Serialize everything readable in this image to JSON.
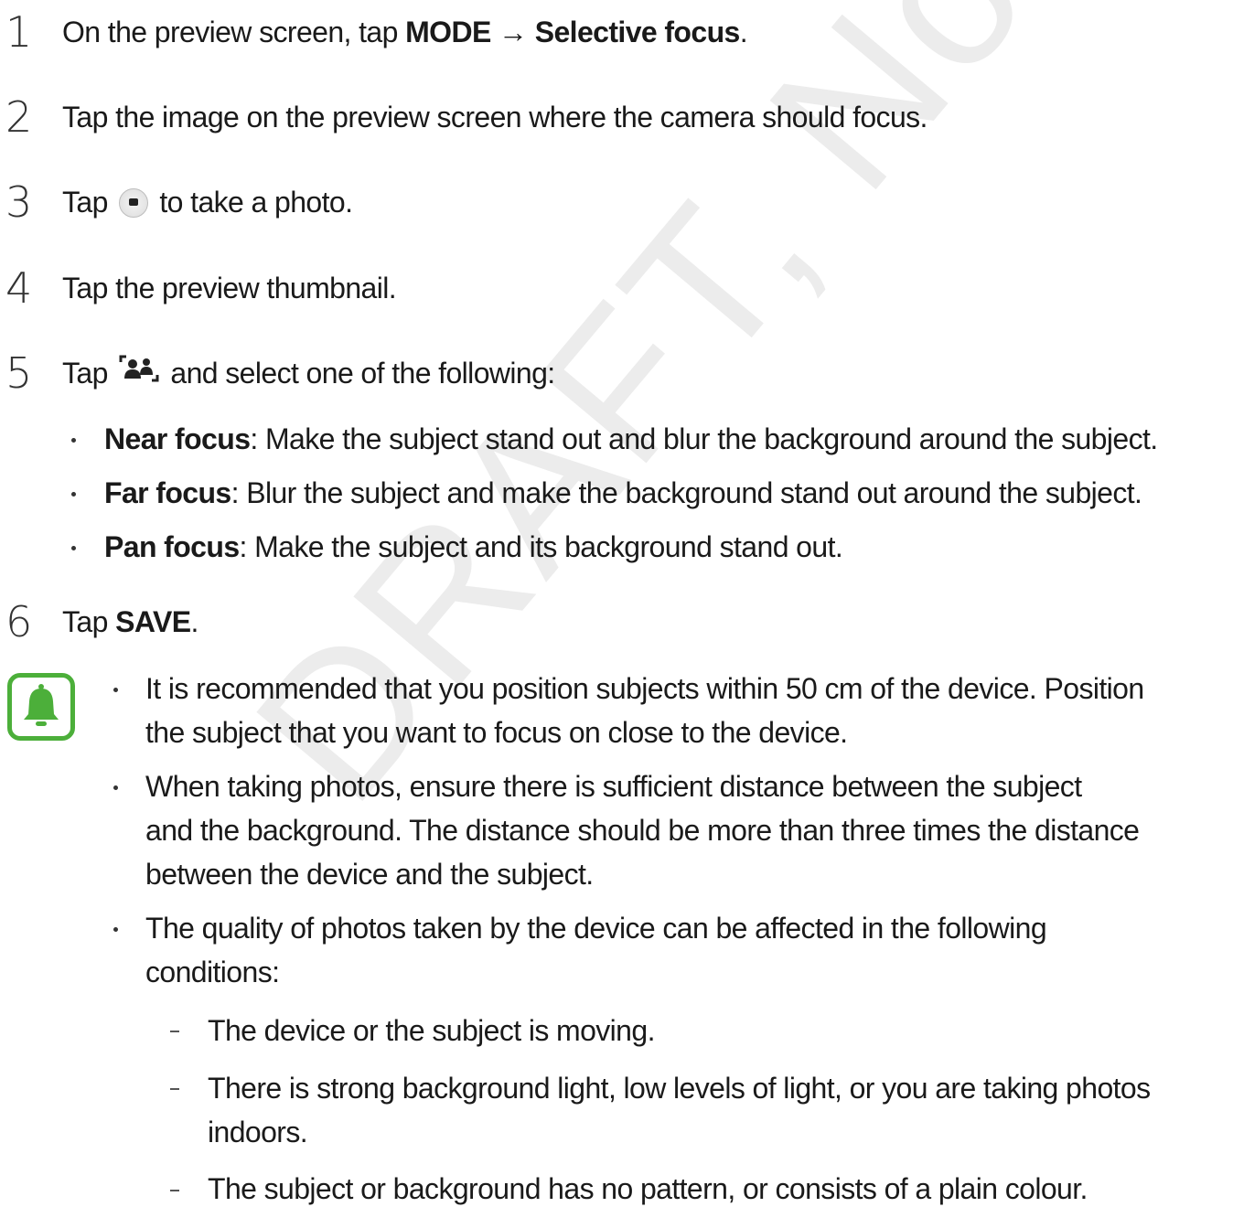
{
  "watermark": "DRAFT, Not Final",
  "steps": [
    {
      "num": "1",
      "pre": "On the preview screen, tap ",
      "b1": "MODE",
      "arrow": " → ",
      "b2": "Selective focus",
      "post": "."
    },
    {
      "num": "2",
      "text": "Tap the image on the preview screen where the camera should focus."
    },
    {
      "num": "3",
      "pre": "Tap ",
      "post": " to take a photo.",
      "icon": "camera-shutter-icon"
    },
    {
      "num": "4",
      "text": "Tap the preview thumbnail."
    },
    {
      "num": "5",
      "pre": "Tap ",
      "post": " and select one of the following:",
      "icon": "selective-focus-icon"
    },
    {
      "num": "6",
      "pre": "Tap ",
      "b1": "SAVE",
      "post": "."
    }
  ],
  "focus_options": [
    {
      "term": "Near focus",
      "desc": ": Make the subject stand out and blur the background around the subject."
    },
    {
      "term": "Far focus",
      "desc": ": Blur the subject and make the background stand out around the subject."
    },
    {
      "term": "Pan focus",
      "desc": ": Make the subject and its background stand out."
    }
  ],
  "note": {
    "icon": "notification-bell-icon",
    "accent_color": "#4caf3a",
    "bullets": [
      {
        "lines": [
          "It is recommended that you position subjects within 50 cm of the device. Position",
          "the subject that you want to focus on close to the device."
        ]
      },
      {
        "lines": [
          "When taking photos, ensure there is sufficient distance between the subject",
          "and the background. The distance should be more than three times the distance",
          "between the device and the subject."
        ]
      },
      {
        "lines": [
          "The quality of photos taken by the device can be affected in the following",
          "conditions:"
        ]
      }
    ],
    "sub_bullets": [
      {
        "lines": [
          "The device or the subject is moving."
        ]
      },
      {
        "lines": [
          "There is strong background light, low levels of light, or you are taking photos",
          "indoors."
        ]
      },
      {
        "lines": [
          "The subject or background has no pattern, or consists of a plain colour."
        ]
      }
    ]
  }
}
